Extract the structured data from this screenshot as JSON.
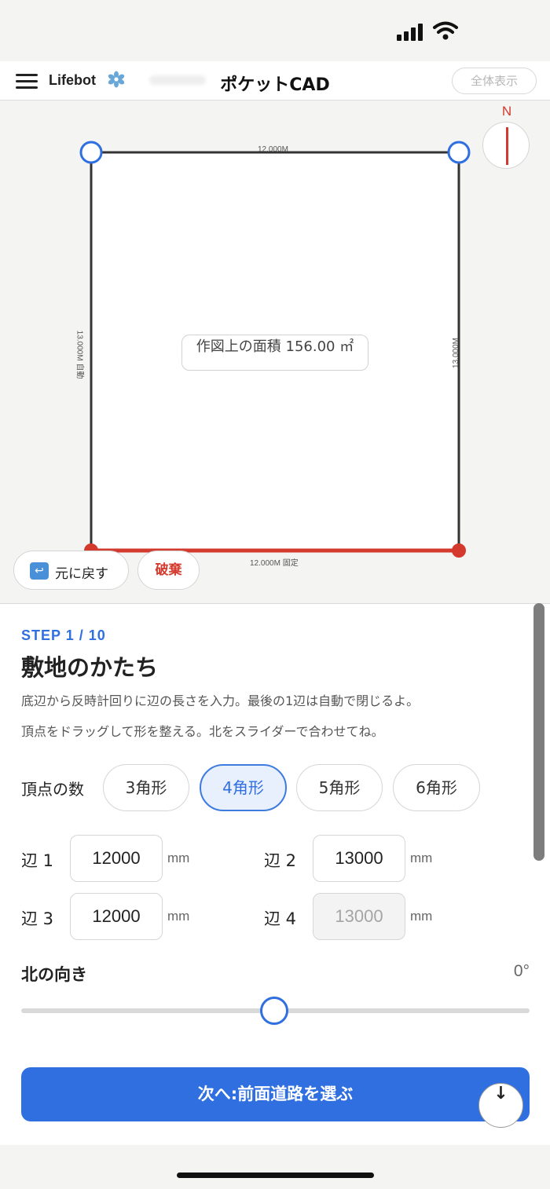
{
  "header": {
    "brand": "Lifebot",
    "title": "ポケットCAD",
    "fit_button": "全体表示"
  },
  "canvas": {
    "compass_label": "N",
    "dimensions": {
      "top": "12.000M",
      "right": "13.000M",
      "left": "13.000M 自動",
      "bottom": "12.000M 固定"
    },
    "area_label": "作図上の面積 156.00 ㎡",
    "undo_label": "元に戻す",
    "discard_label": "破棄"
  },
  "panel": {
    "step": "STEP 1 / 10",
    "title": "敷地のかたち",
    "desc1": "底辺から反時計回りに辺の長さを入力。最後の1辺は自動で閉じるよ。",
    "desc2": "頂点をドラッグして形を整える。北をスライダーで合わせてね。",
    "vertex_label": "頂点の数",
    "shapes": [
      "3角形",
      "4角形",
      "5角形",
      "6角形"
    ],
    "selected_shape": "4角形",
    "sides": [
      {
        "label": "辺 1",
        "value": "12000",
        "unit": "mm",
        "editable": true
      },
      {
        "label": "辺 2",
        "value": "13000",
        "unit": "mm",
        "editable": true
      },
      {
        "label": "辺 3",
        "value": "12000",
        "unit": "mm",
        "editable": true
      },
      {
        "label": "辺 4",
        "value": "13000",
        "unit": "mm",
        "editable": false
      }
    ],
    "north_label": "北の向き",
    "north_value": "0°",
    "north_slider_fraction": 0.5,
    "next_button": "次へ:前面道路を選ぶ"
  },
  "colors": {
    "accent_blue": "#2f6fdf",
    "fixed_edge_red": "#d3392c",
    "vertex_blue": "#2f6fdf"
  }
}
